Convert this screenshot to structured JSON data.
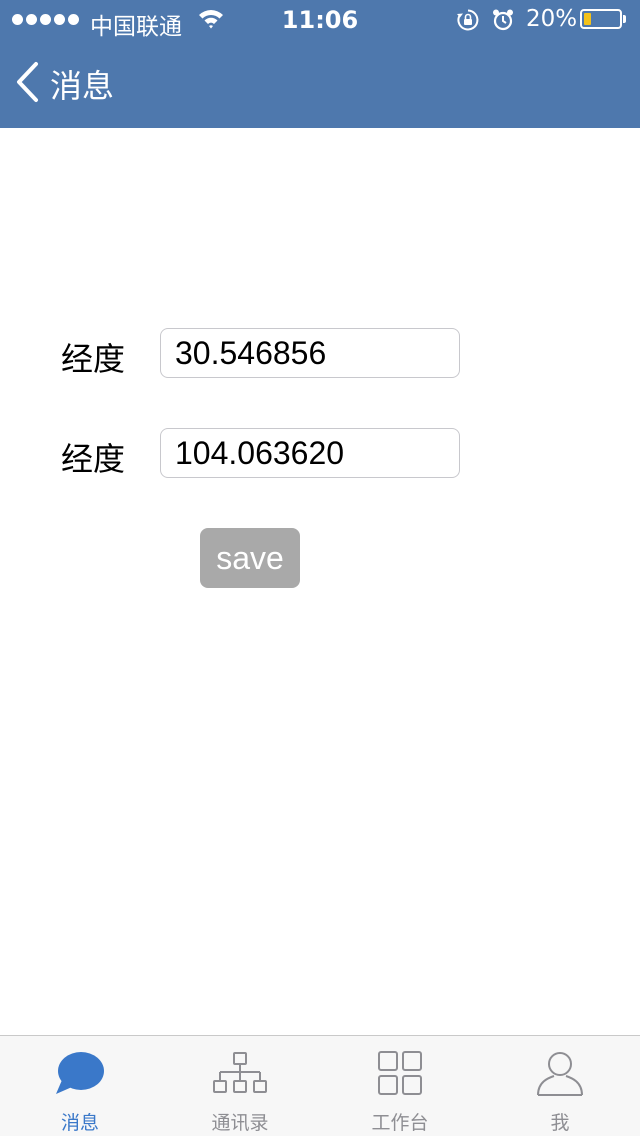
{
  "status_bar": {
    "carrier": "中国联通",
    "time": "11:06",
    "battery_percent_text": "20%",
    "battery_level": 0.2,
    "icons": [
      "signal-dots-icon",
      "wifi-icon",
      "rotation-lock-icon",
      "alarm-icon",
      "battery-icon"
    ]
  },
  "nav": {
    "back_icon": "chevron-left-icon",
    "title": "消息"
  },
  "form": {
    "latitude_label": "经度",
    "latitude_value": "30.546856",
    "longitude_label": "经度",
    "longitude_value": "104.063620",
    "save_label": "save"
  },
  "tabs": [
    {
      "label": "消息",
      "icon": "chat-bubble-icon",
      "active": true
    },
    {
      "label": "通讯录",
      "icon": "org-chart-icon",
      "active": false
    },
    {
      "label": "工作台",
      "icon": "grid-icon",
      "active": false
    },
    {
      "label": "我",
      "icon": "person-icon",
      "active": false
    }
  ],
  "colors": {
    "header_bg": "#4e78ad",
    "accent": "#3a78c9",
    "button_bg": "#a9a9a9",
    "battery_fill": "#f4c21a",
    "tab_inactive": "#8e8e93"
  }
}
